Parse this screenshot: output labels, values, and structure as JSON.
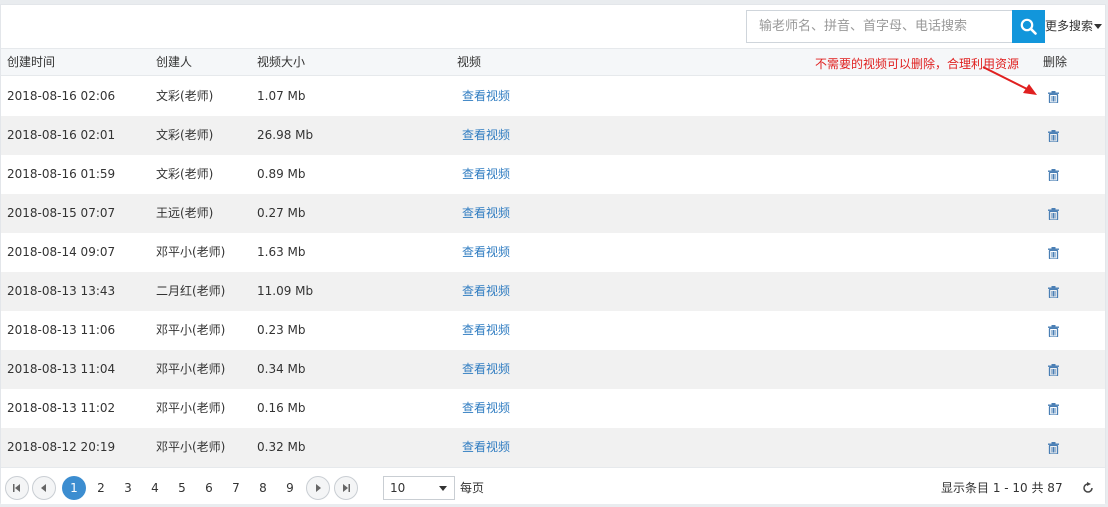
{
  "search": {
    "placeholder": "输老师名、拼音、首字母、电话搜索",
    "more_label": "更多搜索"
  },
  "columns": {
    "created_time": "创建时间",
    "creator": "创建人",
    "size": "视频大小",
    "video": "视频",
    "delete": "删除"
  },
  "annotation": "不需要的视频可以删除，合理利用资源",
  "rows": [
    {
      "time": "2018-08-16 02:06",
      "creator": "文彩(老师)",
      "size": "1.07 Mb",
      "link": "查看视频"
    },
    {
      "time": "2018-08-16 02:01",
      "creator": "文彩(老师)",
      "size": "26.98 Mb",
      "link": "查看视频"
    },
    {
      "time": "2018-08-16 01:59",
      "creator": "文彩(老师)",
      "size": "0.89 Mb",
      "link": "查看视频"
    },
    {
      "time": "2018-08-15 07:07",
      "creator": "王远(老师)",
      "size": "0.27 Mb",
      "link": "查看视频"
    },
    {
      "time": "2018-08-14 09:07",
      "creator": "邓平小(老师)",
      "size": "1.63 Mb",
      "link": "查看视频"
    },
    {
      "time": "2018-08-13 13:43",
      "creator": "二月红(老师)",
      "size": "11.09 Mb",
      "link": "查看视频"
    },
    {
      "time": "2018-08-13 11:06",
      "creator": "邓平小(老师)",
      "size": "0.23 Mb",
      "link": "查看视频"
    },
    {
      "time": "2018-08-13 11:04",
      "creator": "邓平小(老师)",
      "size": "0.34 Mb",
      "link": "查看视频"
    },
    {
      "time": "2018-08-13 11:02",
      "creator": "邓平小(老师)",
      "size": "0.16 Mb",
      "link": "查看视频"
    },
    {
      "time": "2018-08-12 20:19",
      "creator": "邓平小(老师)",
      "size": "0.32 Mb",
      "link": "查看视频"
    }
  ],
  "pagination": {
    "pages": [
      "1",
      "2",
      "3",
      "4",
      "5",
      "6",
      "7",
      "8",
      "9"
    ],
    "current": "1",
    "page_size": "10",
    "per_page_label": "每页",
    "info": "显示条目 1 - 10 共 87"
  },
  "colors": {
    "accent": "#1296db",
    "link": "#2f7cc1",
    "annotation": "#e02020",
    "active_page": "#3c8dd0"
  }
}
